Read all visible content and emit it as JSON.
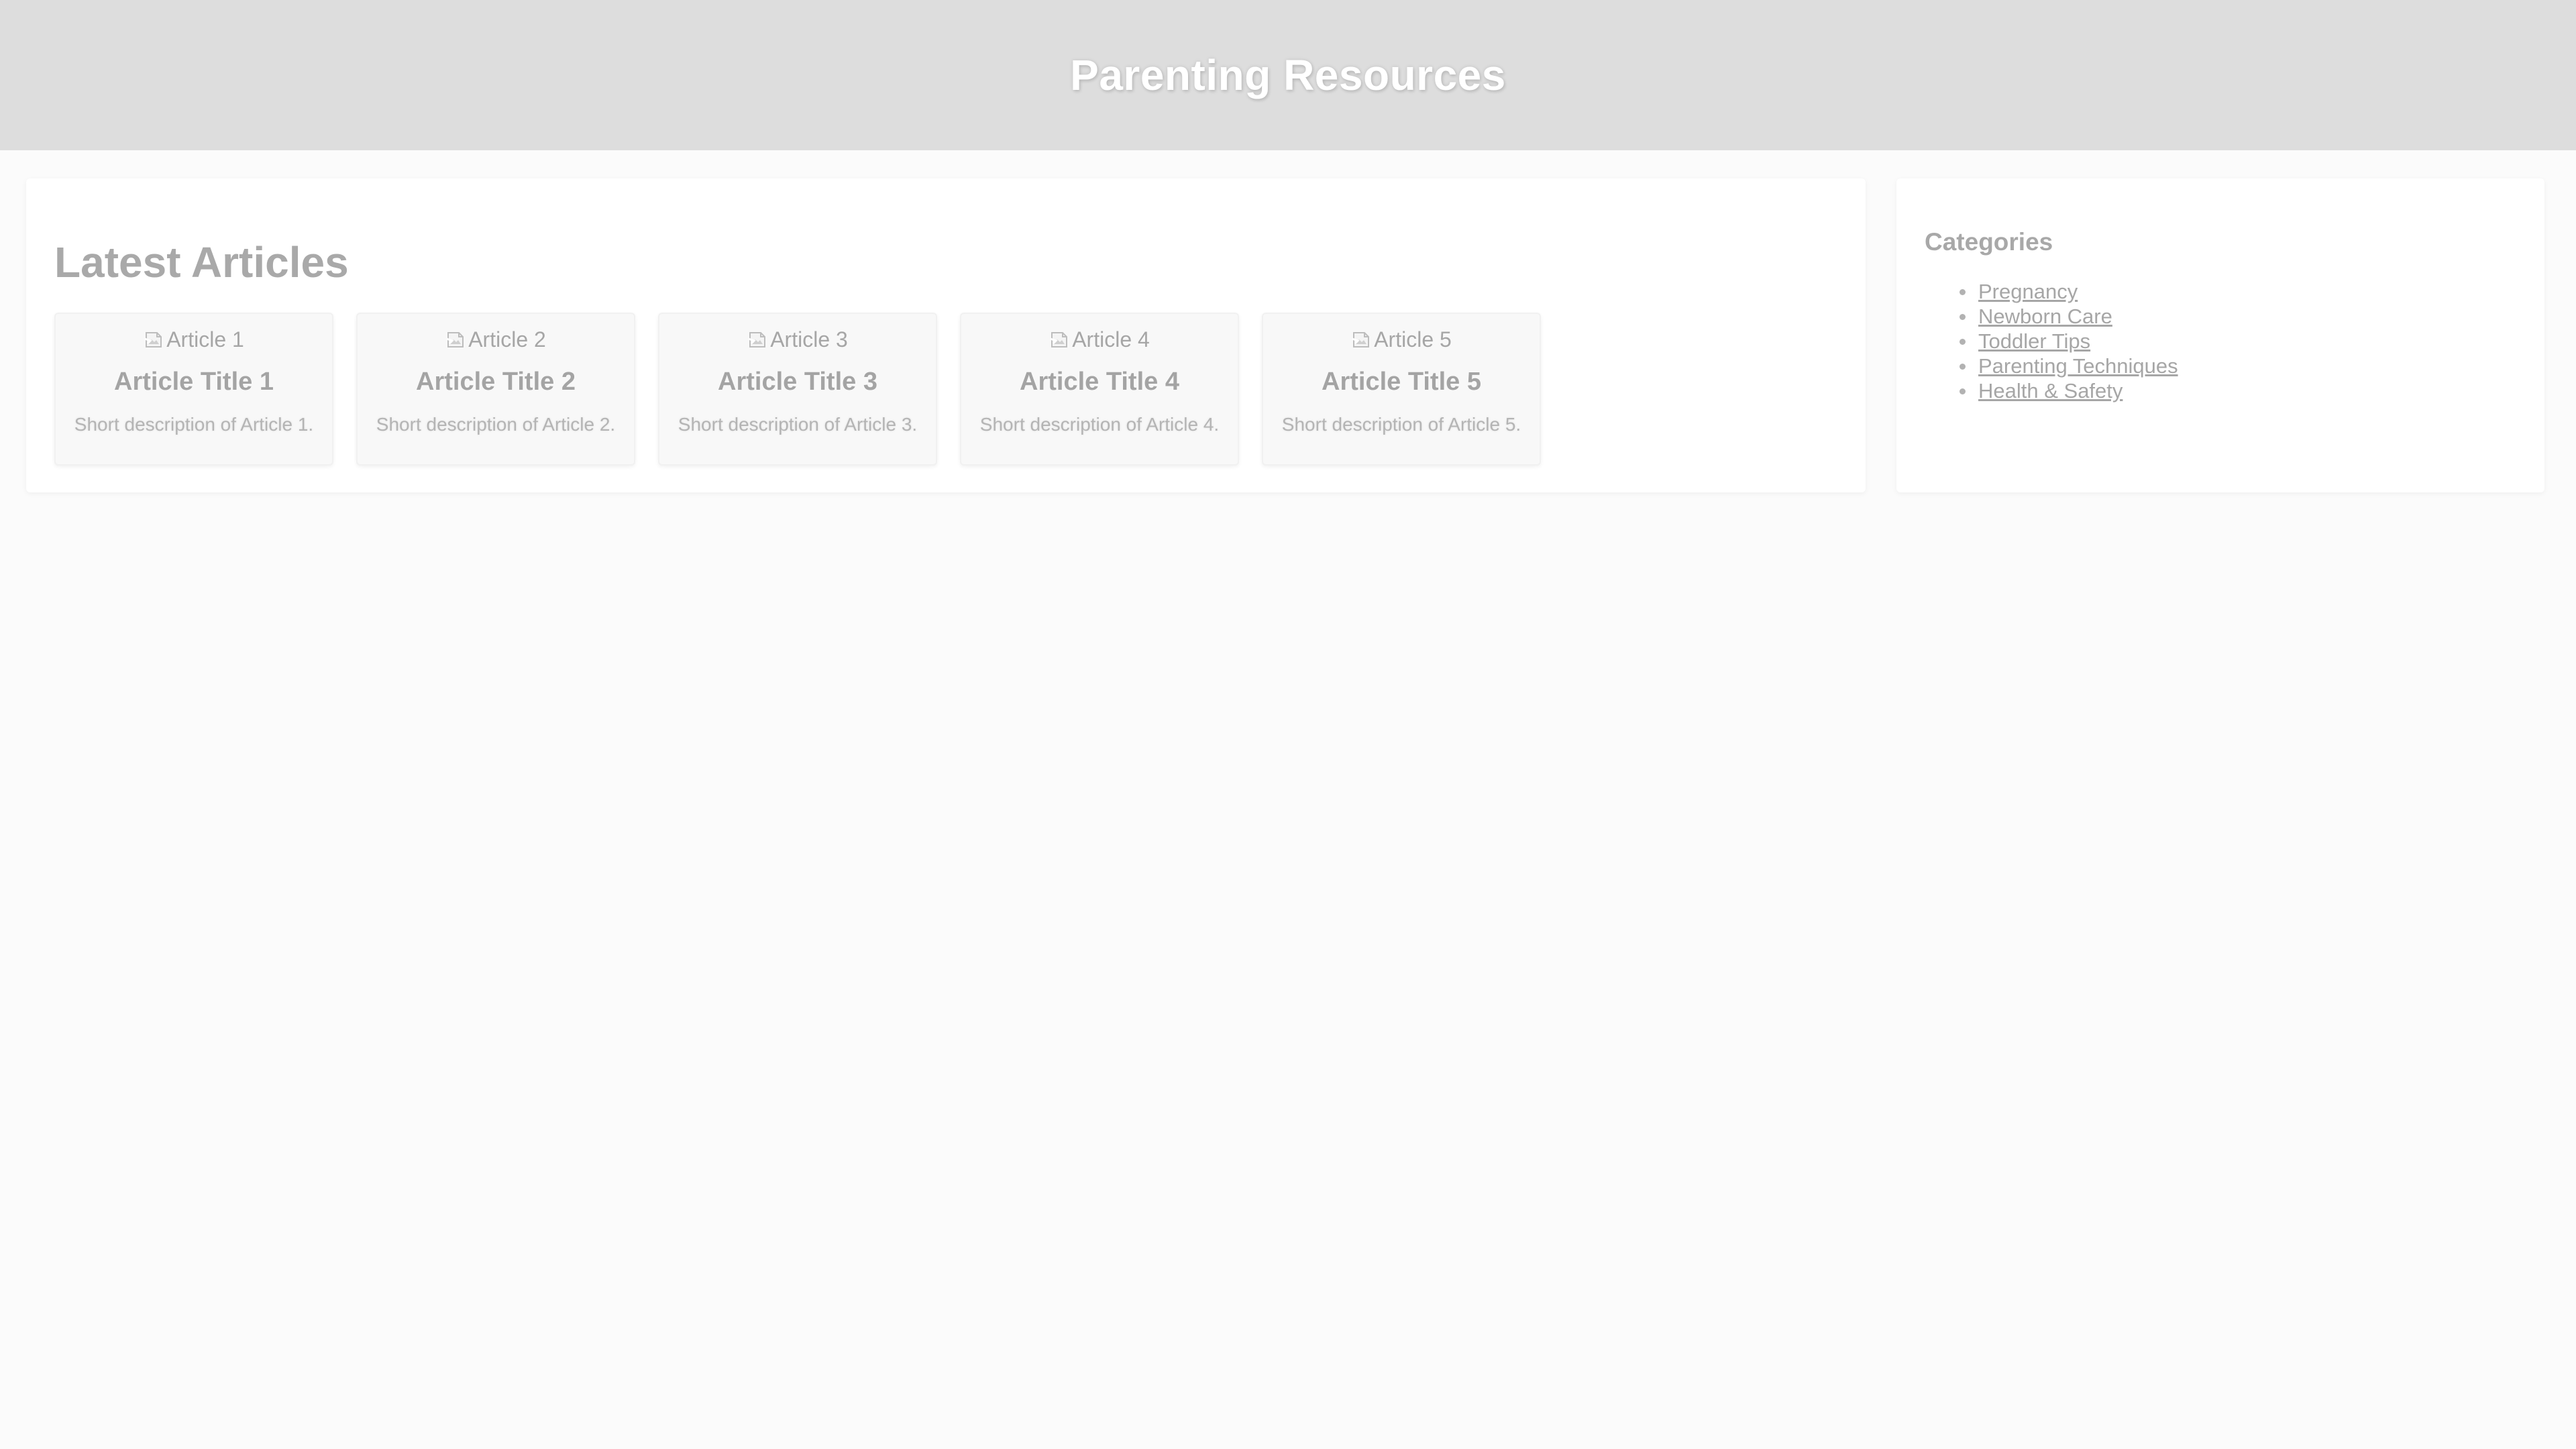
{
  "header": {
    "title": "Parenting Resources"
  },
  "main": {
    "heading": "Latest Articles",
    "articles": [
      {
        "image_alt": "Article 1",
        "title": "Article Title 1",
        "description": "Short description of Article 1."
      },
      {
        "image_alt": "Article 2",
        "title": "Article Title 2",
        "description": "Short description of Article 2."
      },
      {
        "image_alt": "Article 3",
        "title": "Article Title 3",
        "description": "Short description of Article 3."
      },
      {
        "image_alt": "Article 4",
        "title": "Article Title 4",
        "description": "Short description of Article 4."
      },
      {
        "image_alt": "Article 5",
        "title": "Article Title 5",
        "description": "Short description of Article 5."
      }
    ]
  },
  "sidebar": {
    "heading": "Categories",
    "categories": [
      {
        "label": "Pregnancy"
      },
      {
        "label": "Newborn Care"
      },
      {
        "label": "Toddler Tips"
      },
      {
        "label": "Parenting Techniques"
      },
      {
        "label": "Health & Safety"
      }
    ]
  },
  "colors": {
    "header_background": "#dddddd",
    "page_background": "#fbfbfb",
    "card_background": "#f8f8f8",
    "text_muted": "#a8a8a8"
  },
  "icons": {
    "card_image": "broken-image-icon",
    "list_bullet": "bullet-icon"
  }
}
